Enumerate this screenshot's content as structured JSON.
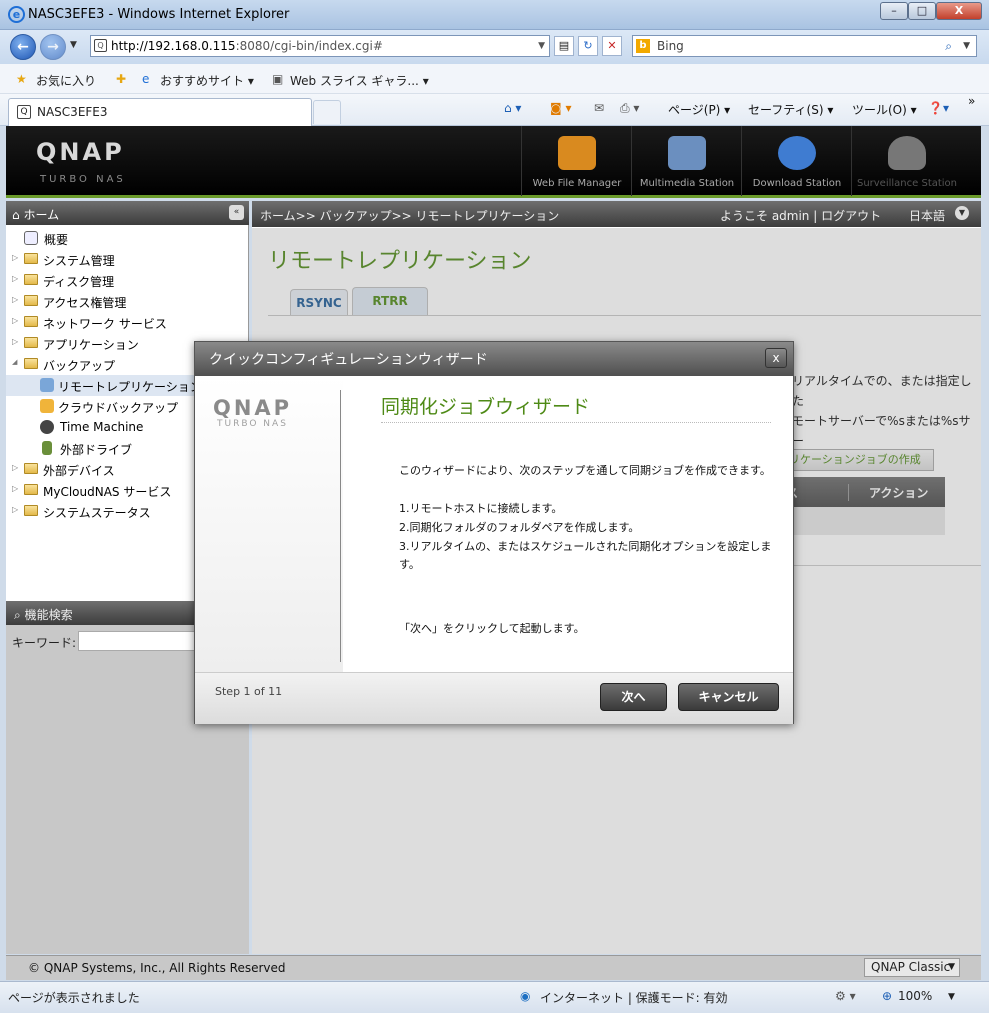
{
  "window": {
    "title": "NASC3EFE3 - Windows Internet Explorer",
    "minimize": "–",
    "maximize": "□",
    "close": "X"
  },
  "address_bar": {
    "url_host": "http://192.168.0.115",
    "url_rest": ":8080/cgi-bin/index.cgi#",
    "search_engine": "Bing",
    "search_icon": "magnifier-icon"
  },
  "favorites_bar": {
    "favorites": "お気に入り",
    "suggested_sites": "おすすめサイト ▾",
    "web_slice": "Web スライス ギャラ... ▾"
  },
  "tab_bar": {
    "active_tab": "NASC3EFE3",
    "page_menu": "ページ(P) ▾",
    "safety_menu": "セーフティ(S) ▾",
    "tools_menu": "ツール(O) ▾",
    "more": "»"
  },
  "qnap_header": {
    "logo": "QNAP",
    "subtitle": "TURBO NAS",
    "stations": [
      {
        "label": "Web File Manager",
        "icon": "folder-search-icon",
        "color": "#d98a1f"
      },
      {
        "label": "Multimedia Station",
        "icon": "media-icon",
        "color": "#6b8fbf"
      },
      {
        "label": "Download Station",
        "icon": "download-icon",
        "color": "#3f7cd1"
      },
      {
        "label": "Surveillance Station",
        "icon": "camera-icon",
        "color": "#777777"
      }
    ]
  },
  "nav": {
    "home": "ホーム",
    "items": [
      {
        "label": "概要"
      },
      {
        "label": "システム管理"
      },
      {
        "label": "ディスク管理"
      },
      {
        "label": "アクセス権管理"
      },
      {
        "label": "ネットワーク サービス"
      },
      {
        "label": "アプリケーション"
      },
      {
        "label": "バックアップ"
      },
      {
        "label": "リモートレプリケーション"
      },
      {
        "label": "クラウドバックアップ"
      },
      {
        "label": "Time Machine"
      },
      {
        "label": "外部ドライブ"
      },
      {
        "label": "外部デバイス"
      },
      {
        "label": "MyCloudNAS サービス"
      },
      {
        "label": "システムステータス"
      }
    ],
    "search_title": "機能検索",
    "keyword_label": "キーワード:"
  },
  "main": {
    "breadcrumb": "ホーム>> バックアップ>> リモートレプリケーション",
    "welcome": "ようこそ admin | ログアウト",
    "language": "日本語",
    "page_title": "リモートレプリケーション",
    "tabs": [
      {
        "label": "RSYNC"
      },
      {
        "label": "RTRR"
      }
    ],
    "desc_line1": "リアルタイムでの、または指定した",
    "desc_line2": "モートサーバーで%sまたは%sサー",
    "create_button": "リケーションジョブの作成",
    "col_status": "ス",
    "col_action": "アクション"
  },
  "modal": {
    "title": "クイックコンフィギュレーションウィザード",
    "logo": "QNAP",
    "logo_sub": "TURBO NAS",
    "heading": "同期化ジョブウィザード",
    "intro": "このウィザードにより、次のステップを通して同期ジョブを作成できます。",
    "step1": "1.リモートホストに接続します。",
    "step2": "2.同期化フォルダのフォルダペアを作成します。",
    "step3": "3.リアルタイムの、またはスケジュールされた同期化オプションを設定します。",
    "hint": "「次へ」をクリックして起動します。",
    "step_indicator": "Step 1 of 11",
    "next_button": "次へ",
    "cancel_button": "キャンセル"
  },
  "footer": {
    "copyright": "© QNAP Systems, Inc., All Rights Reserved",
    "theme": "QNAP Classic"
  },
  "status_bar": {
    "status": "ページが表示されました",
    "zone": "インターネット | 保護モード: 有効",
    "zoom": "100%"
  }
}
